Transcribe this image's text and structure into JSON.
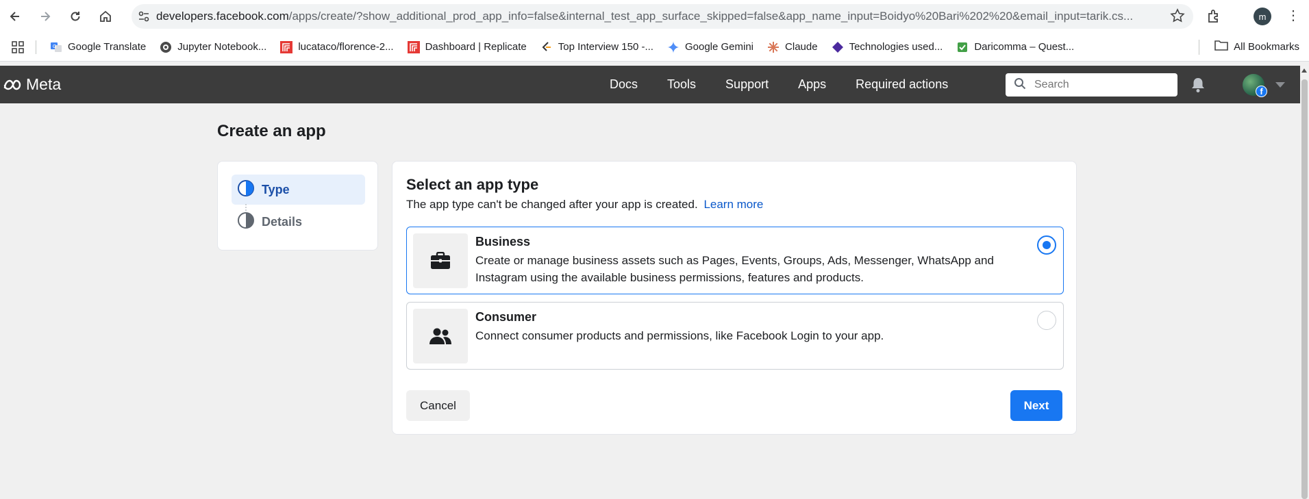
{
  "browser": {
    "url_host": "developers.facebook.com",
    "url_rest": "/apps/create/?show_additional_prod_app_info=false&internal_test_app_surface_skipped=false&app_name_input=Boidyo%20Bari%202%20&email_input=tarik.cs...",
    "profile_initial": "m",
    "bookmarks": [
      {
        "label": "Google Translate",
        "icon": "google-translate-icon"
      },
      {
        "label": "Jupyter Notebook...",
        "icon": "jupyter-icon"
      },
      {
        "label": "lucataco/florence-2...",
        "icon": "replicate-icon"
      },
      {
        "label": "Dashboard | Replicate",
        "icon": "replicate-icon"
      },
      {
        "label": "Top Interview 150 -...",
        "icon": "leetcode-icon"
      },
      {
        "label": "Google Gemini",
        "icon": "gemini-icon"
      },
      {
        "label": "Claude",
        "icon": "claude-icon"
      },
      {
        "label": "Technologies used...",
        "icon": "diamond-icon"
      },
      {
        "label": "Daricomma – Quest...",
        "icon": "check-icon"
      }
    ],
    "all_bookmarks_label": "All Bookmarks"
  },
  "header": {
    "logo_text": "Meta",
    "nav": [
      "Docs",
      "Tools",
      "Support",
      "Apps",
      "Required actions"
    ],
    "search_placeholder": "Search",
    "facebook_badge": "f"
  },
  "page": {
    "title": "Create an app",
    "steps": [
      {
        "label": "Type",
        "active": true
      },
      {
        "label": "Details",
        "active": false
      }
    ],
    "card": {
      "title": "Select an app type",
      "subtitle": "The app type can't be changed after your app is created.",
      "learn_more": "Learn more",
      "options": [
        {
          "title": "Business",
          "description": "Create or manage business assets such as Pages, Events, Groups, Ads, Messenger, WhatsApp and Instagram using the available business permissions, features and products.",
          "icon": "briefcase-icon",
          "selected": true
        },
        {
          "title": "Consumer",
          "description": "Connect consumer products and permissions, like Facebook Login to your app.",
          "icon": "people-icon",
          "selected": false
        }
      ],
      "cancel_label": "Cancel",
      "next_label": "Next"
    }
  },
  "colors": {
    "accent": "#1877f2",
    "header_bg": "#3c3c3c",
    "page_bg": "#f0f0f0",
    "step_active_bg": "#e7f0fc"
  }
}
